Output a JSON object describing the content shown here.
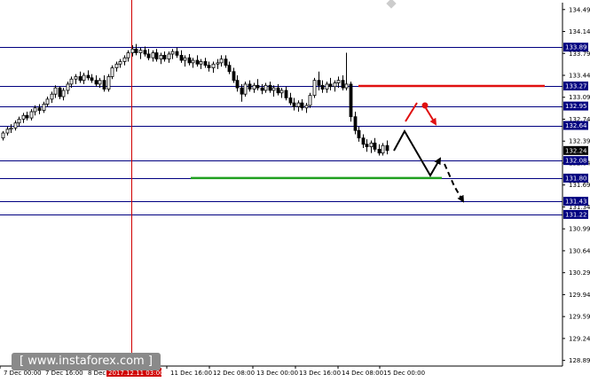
{
  "chart_data": {
    "type": "candlestick",
    "symbol": "USDJPY",
    "ylim": [
      128.8,
      134.6
    ],
    "y_ticks": [
      "134.49",
      "134.14",
      "133.79",
      "133.44",
      "133.09",
      "132.74",
      "132.39",
      "132.04",
      "131.69",
      "131.34",
      "130.99",
      "130.64",
      "130.29",
      "129.94",
      "129.59",
      "129.24",
      "128.89"
    ],
    "x_ticks": [
      "7 Dec 00:00",
      "7 Dec 16:00",
      "8 Dec 08:00",
      "2017.12.11 03:00",
      "11 Dec 16:00",
      "12 Dec 08:00",
      "13 Dec 00:00",
      "13 Dec 16:00",
      "14 Dec 08:00",
      "15 Dec 00:00"
    ],
    "highlighted_x_tick": "2017.12.11 03:00",
    "levels": [
      {
        "value": 133.89,
        "label": "133.89",
        "color": "#000080"
      },
      {
        "value": 133.27,
        "label": "133.27",
        "color": "#000080"
      },
      {
        "value": 132.95,
        "label": "132.95",
        "color": "#000080"
      },
      {
        "value": 132.64,
        "label": "132.64",
        "color": "#000080"
      },
      {
        "value": 132.08,
        "label": "132.08",
        "color": "#000080"
      },
      {
        "value": 131.8,
        "label": "131.80",
        "color": "#000080"
      },
      {
        "value": 131.43,
        "label": "131.43",
        "color": "#000080"
      },
      {
        "value": 131.22,
        "label": "131.22",
        "color": "#000080"
      }
    ],
    "current_price": {
      "value": 132.24,
      "label": "132.24",
      "color": "#000000"
    },
    "resistance_line": {
      "value": 133.27,
      "color": "#e01010"
    },
    "support_line": {
      "value": 131.8,
      "color": "#20a020"
    },
    "vertical_marker_color": "#d00000",
    "candles": [
      [
        132.44,
        132.55,
        132.4,
        132.52
      ],
      [
        132.52,
        132.62,
        132.48,
        132.58
      ],
      [
        132.58,
        132.66,
        132.52,
        132.6
      ],
      [
        132.6,
        132.72,
        132.56,
        132.68
      ],
      [
        132.68,
        132.78,
        132.62,
        132.74
      ],
      [
        132.74,
        132.84,
        132.68,
        132.8
      ],
      [
        132.8,
        132.86,
        132.72,
        132.76
      ],
      [
        132.76,
        132.9,
        132.72,
        132.86
      ],
      [
        132.86,
        132.96,
        132.8,
        132.92
      ],
      [
        132.92,
        132.98,
        132.82,
        132.88
      ],
      [
        132.88,
        133.02,
        132.84,
        132.98
      ],
      [
        132.98,
        133.1,
        132.94,
        133.06
      ],
      [
        133.06,
        133.18,
        133.0,
        133.14
      ],
      [
        133.14,
        133.28,
        133.08,
        133.24
      ],
      [
        133.24,
        133.26,
        133.06,
        133.1
      ],
      [
        133.1,
        133.24,
        133.04,
        133.2
      ],
      [
        133.2,
        133.34,
        133.14,
        133.3
      ],
      [
        133.3,
        133.42,
        133.24,
        133.38
      ],
      [
        133.38,
        133.46,
        133.3,
        133.42
      ],
      [
        133.42,
        133.5,
        133.32,
        133.36
      ],
      [
        133.36,
        133.48,
        133.3,
        133.44
      ],
      [
        133.44,
        133.52,
        133.36,
        133.4
      ],
      [
        133.4,
        133.46,
        133.32,
        133.36
      ],
      [
        133.36,
        133.44,
        133.26,
        133.3
      ],
      [
        133.3,
        133.4,
        133.24,
        133.36
      ],
      [
        133.36,
        133.44,
        133.18,
        133.22
      ],
      [
        133.22,
        133.46,
        133.18,
        133.42
      ],
      [
        133.42,
        133.6,
        133.38,
        133.56
      ],
      [
        133.56,
        133.66,
        133.5,
        133.62
      ],
      [
        133.62,
        133.7,
        133.56,
        133.66
      ],
      [
        133.66,
        133.76,
        133.6,
        133.72
      ],
      [
        133.72,
        133.84,
        133.66,
        133.8
      ],
      [
        133.8,
        133.92,
        133.74,
        133.86
      ],
      [
        133.86,
        133.94,
        133.76,
        133.8
      ],
      [
        133.8,
        133.88,
        133.7,
        133.84
      ],
      [
        133.84,
        133.9,
        133.74,
        133.78
      ],
      [
        133.78,
        133.86,
        133.68,
        133.72
      ],
      [
        133.72,
        133.84,
        133.66,
        133.8
      ],
      [
        133.8,
        133.86,
        133.66,
        133.7
      ],
      [
        133.7,
        133.8,
        133.62,
        133.76
      ],
      [
        133.76,
        133.82,
        133.66,
        133.7
      ],
      [
        133.7,
        133.82,
        133.64,
        133.78
      ],
      [
        133.78,
        133.86,
        133.7,
        133.82
      ],
      [
        133.82,
        133.88,
        133.72,
        133.76
      ],
      [
        133.76,
        133.84,
        133.64,
        133.68
      ],
      [
        133.68,
        133.76,
        133.58,
        133.72
      ],
      [
        133.72,
        133.78,
        133.6,
        133.64
      ],
      [
        133.64,
        133.72,
        133.56,
        133.68
      ],
      [
        133.68,
        133.76,
        133.58,
        133.62
      ],
      [
        133.62,
        133.7,
        133.54,
        133.66
      ],
      [
        133.66,
        133.72,
        133.56,
        133.6
      ],
      [
        133.6,
        133.66,
        133.5,
        133.56
      ],
      [
        133.56,
        133.66,
        133.48,
        133.62
      ],
      [
        133.62,
        133.7,
        133.54,
        133.64
      ],
      [
        133.64,
        133.76,
        133.58,
        133.7
      ],
      [
        133.7,
        133.76,
        133.56,
        133.6
      ],
      [
        133.6,
        133.66,
        133.46,
        133.5
      ],
      [
        133.5,
        133.56,
        133.32,
        133.36
      ],
      [
        133.36,
        133.44,
        133.18,
        133.24
      ],
      [
        133.24,
        133.3,
        133.02,
        133.14
      ],
      [
        133.14,
        133.34,
        133.1,
        133.3
      ],
      [
        133.3,
        133.36,
        133.18,
        133.22
      ],
      [
        133.22,
        133.32,
        133.16,
        133.28
      ],
      [
        133.28,
        133.38,
        133.2,
        133.24
      ],
      [
        133.24,
        133.3,
        133.14,
        133.2
      ],
      [
        133.2,
        133.32,
        133.16,
        133.28
      ],
      [
        133.28,
        133.34,
        133.16,
        133.2
      ],
      [
        133.2,
        133.28,
        133.1,
        133.24
      ],
      [
        133.24,
        133.3,
        133.12,
        133.16
      ],
      [
        133.16,
        133.24,
        133.08,
        133.2
      ],
      [
        133.2,
        133.26,
        133.04,
        133.08
      ],
      [
        133.08,
        133.16,
        132.96,
        133.0
      ],
      [
        133.0,
        133.08,
        132.88,
        132.94
      ],
      [
        132.94,
        133.04,
        132.86,
        133.0
      ],
      [
        133.0,
        133.06,
        132.88,
        132.92
      ],
      [
        132.92,
        133.0,
        132.84,
        132.96
      ],
      [
        132.96,
        133.16,
        132.92,
        133.12
      ],
      [
        133.12,
        133.4,
        133.08,
        133.36
      ],
      [
        133.36,
        133.5,
        133.2,
        133.28
      ],
      [
        133.28,
        133.36,
        133.16,
        133.22
      ],
      [
        133.22,
        133.34,
        133.16,
        133.3
      ],
      [
        133.3,
        133.4,
        133.2,
        133.26
      ],
      [
        133.26,
        133.36,
        133.18,
        133.32
      ],
      [
        133.32,
        133.42,
        133.24,
        133.36
      ],
      [
        133.36,
        133.44,
        133.2,
        133.24
      ],
      [
        133.24,
        133.8,
        133.2,
        133.3
      ],
      [
        133.3,
        133.34,
        132.7,
        132.78
      ],
      [
        132.78,
        132.86,
        132.5,
        132.56
      ],
      [
        132.56,
        132.62,
        132.38,
        132.44
      ],
      [
        132.44,
        132.5,
        132.28,
        132.34
      ],
      [
        132.34,
        132.42,
        132.22,
        132.3
      ],
      [
        132.3,
        132.4,
        132.2,
        132.36
      ],
      [
        132.36,
        132.44,
        132.22,
        132.26
      ],
      [
        132.26,
        132.34,
        132.16,
        132.2
      ],
      [
        132.2,
        132.36,
        132.16,
        132.32
      ],
      [
        132.32,
        132.4,
        132.18,
        132.24
      ]
    ]
  }
}
